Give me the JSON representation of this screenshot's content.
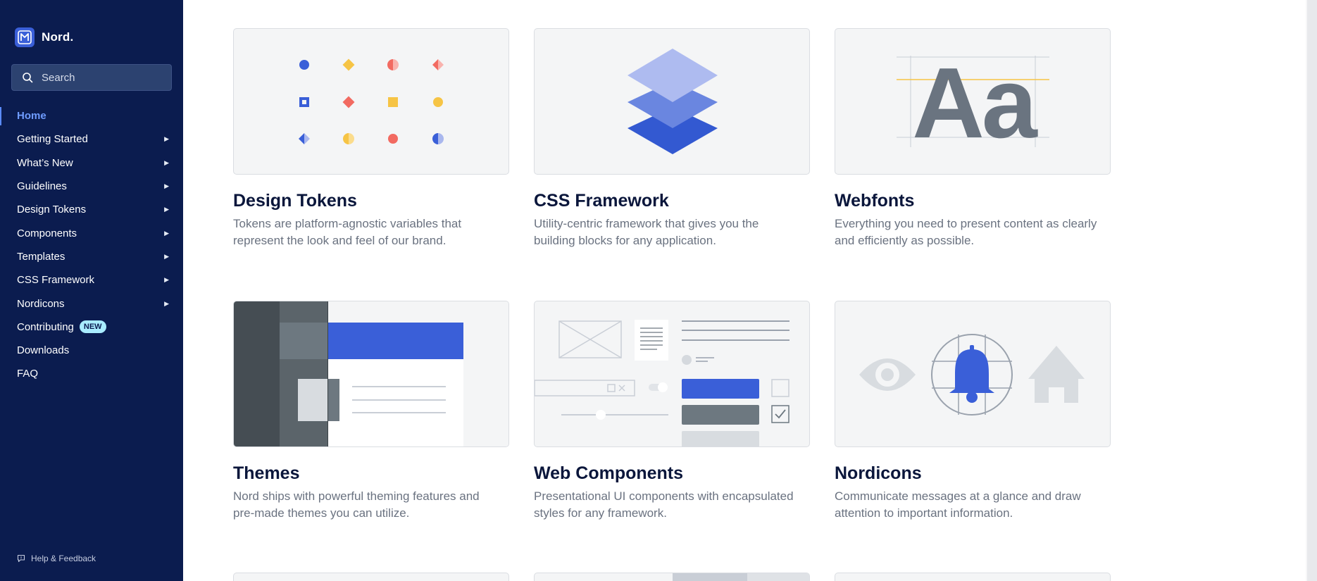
{
  "brand": {
    "name": "Nord."
  },
  "search": {
    "placeholder": "Search"
  },
  "nav": {
    "items": [
      {
        "label": "Home",
        "active": true
      },
      {
        "label": "Getting Started",
        "arrow": "▶"
      },
      {
        "label": "What’s New",
        "arrow": "▶"
      },
      {
        "label": "Guidelines",
        "arrow": "▶"
      },
      {
        "label": "Design Tokens",
        "arrow": "▶"
      },
      {
        "label": "Components",
        "arrow": "▶"
      },
      {
        "label": "Templates",
        "arrow": "▶"
      },
      {
        "label": "CSS Framework",
        "arrow": "▶"
      },
      {
        "label": "Nordicons",
        "arrow": "▶"
      },
      {
        "label": "Contributing",
        "badge": "NEW"
      },
      {
        "label": "Downloads"
      },
      {
        "label": "FAQ"
      }
    ]
  },
  "help": {
    "label": "Help & Feedback"
  },
  "cards": [
    {
      "title": "Design Tokens",
      "desc": "Tokens are platform-agnostic variables that represent the look and feel of our brand."
    },
    {
      "title": "CSS Framework",
      "desc": "Utility-centric framework that gives you the building blocks for any application."
    },
    {
      "title": "Webfonts",
      "desc": "Everything you need to present content as clearly and efficiently as possible.",
      "sample": "Aa"
    },
    {
      "title": "Themes",
      "desc": "Nord ships with powerful theming features and pre-made themes you can utilize."
    },
    {
      "title": "Web Components",
      "desc": "Presentational UI components with encapsulated styles for any framework."
    },
    {
      "title": "Nordicons",
      "desc": "Communicate messages at a glance and draw attention to important information."
    }
  ],
  "colors": {
    "sidebar": "#0b1c4f",
    "accent": "#3a5fd8",
    "active_link": "#6f9cff",
    "badge": "#a9ecff"
  }
}
